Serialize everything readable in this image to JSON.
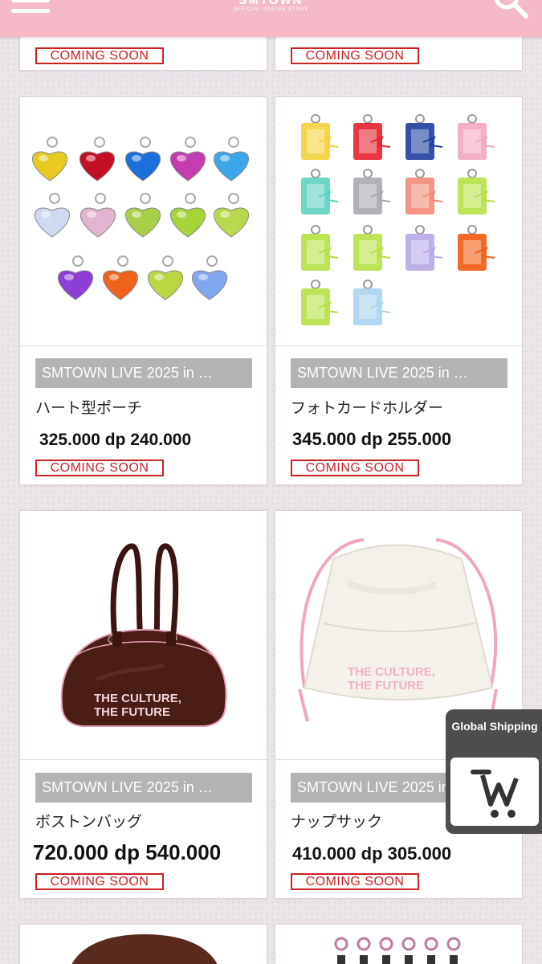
{
  "header": {
    "logo_main": "SMTOWN",
    "logo_sub": "OFFICIAL ONLINE STORE"
  },
  "top_row": [
    {
      "status": "COMING SOON"
    },
    {
      "status": "COMING SOON"
    }
  ],
  "products": [
    {
      "category": "SMTOWN LIVE 2025 in …",
      "name": "ハート型ポーチ",
      "price": "325.000 dp 240.000",
      "status": "COMING SOON"
    },
    {
      "category": "SMTOWN LIVE 2025 in …",
      "name": "フォトカードホルダー",
      "price": "345.000 dp 255.000",
      "status": "COMING SOON"
    },
    {
      "category": "SMTOWN LIVE 2025 in …",
      "name": "ボストンバッグ",
      "price": "720.000 dp 540.000",
      "status": "COMING SOON",
      "print_text": [
        "THE CULTURE,",
        "THE  FUTURE"
      ]
    },
    {
      "category": "SMTOWN LIVE 2025 in …",
      "name": "ナップサック",
      "price": "410.000 dp 305.000",
      "status": "COMING SOON",
      "print_text": [
        "THE CULTURE,",
        "THE  FUTURE"
      ]
    }
  ],
  "global_shipping": {
    "label": "Global Shipping",
    "icon": "cart-w-icon"
  },
  "colors": {
    "header": "#f5b9c8",
    "coming_soon": "#cc2222",
    "tag_bg": "#b3b3b3",
    "bag_brown": "#4a1d17",
    "bag_trim": "#f2b8c6"
  }
}
